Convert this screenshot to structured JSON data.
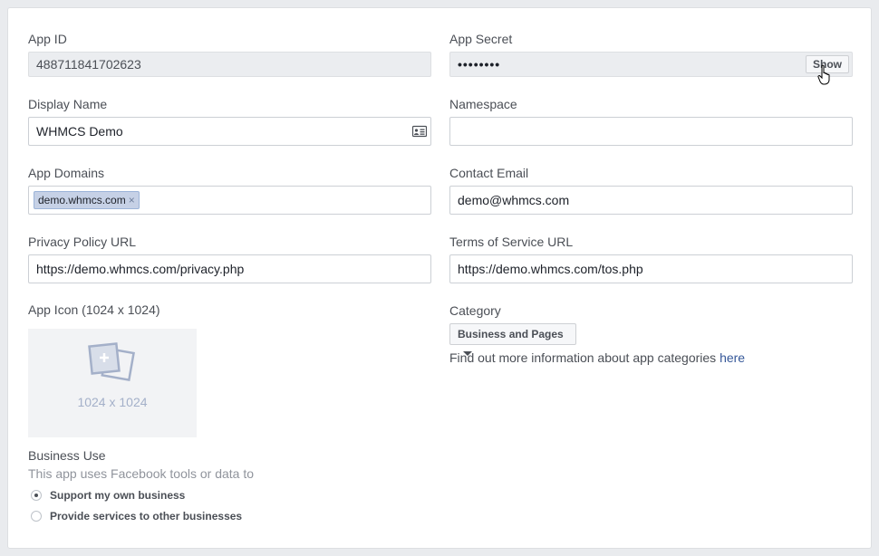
{
  "app_id": {
    "label": "App ID",
    "value": "488711841702623"
  },
  "app_secret": {
    "label": "App Secret",
    "value": "••••••••",
    "show_label": "Show"
  },
  "display_name": {
    "label": "Display Name",
    "value": "WHMCS Demo"
  },
  "namespace": {
    "label": "Namespace",
    "value": ""
  },
  "app_domains": {
    "label": "App Domains",
    "tokens": [
      "demo.whmcs.com"
    ],
    "remove_glyph": "×"
  },
  "contact_email": {
    "label": "Contact Email",
    "value": "demo@whmcs.com"
  },
  "privacy_url": {
    "label": "Privacy Policy URL",
    "value": "https://demo.whmcs.com/privacy.php"
  },
  "tos_url": {
    "label": "Terms of Service URL",
    "value": "https://demo.whmcs.com/tos.php"
  },
  "app_icon": {
    "label": "App Icon (1024 x 1024)",
    "placeholder": "1024 x 1024"
  },
  "category": {
    "label": "Category",
    "selected": "Business and Pages",
    "help_text": "Find out more information about app categories ",
    "help_link": "here"
  },
  "business_use": {
    "label": "Business Use",
    "description": "This app uses Facebook tools or data to",
    "options": [
      {
        "label": "Support my own business",
        "selected": true
      },
      {
        "label": "Provide services to other businesses",
        "selected": false
      }
    ]
  },
  "icons": {
    "contact_card": "contact-card-icon",
    "image_upload": "image-upload-icon",
    "caret": "caret-down-icon",
    "cursor": "hand-cursor"
  },
  "colors": {
    "link": "#365899",
    "token_bg": "#c6d1e6",
    "readonly_bg": "#ebedf0",
    "page_bg": "#e9ebee"
  }
}
